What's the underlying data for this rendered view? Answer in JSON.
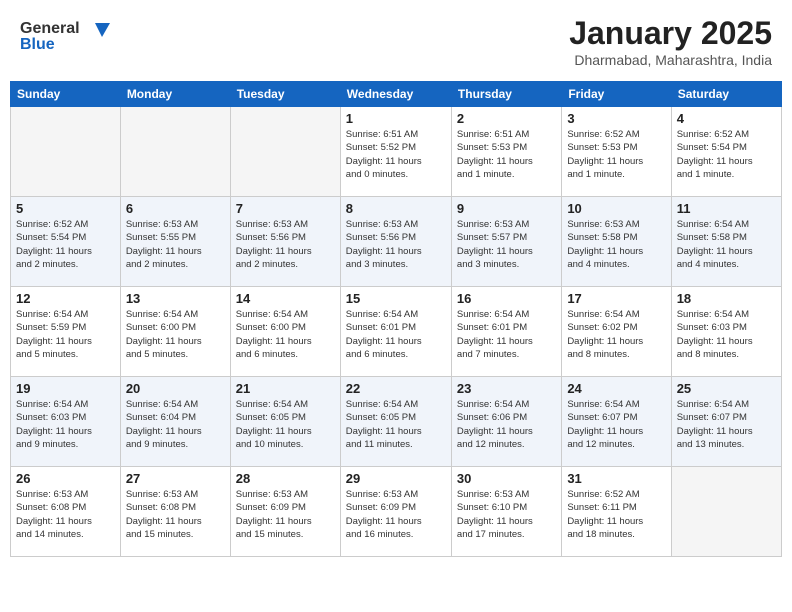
{
  "header": {
    "logo_general": "General",
    "logo_blue": "Blue",
    "month_title": "January 2025",
    "subtitle": "Dharmabad, Maharashtra, India"
  },
  "weekdays": [
    "Sunday",
    "Monday",
    "Tuesday",
    "Wednesday",
    "Thursday",
    "Friday",
    "Saturday"
  ],
  "weeks": [
    [
      {
        "day": "",
        "info": ""
      },
      {
        "day": "",
        "info": ""
      },
      {
        "day": "",
        "info": ""
      },
      {
        "day": "1",
        "info": "Sunrise: 6:51 AM\nSunset: 5:52 PM\nDaylight: 11 hours\nand 0 minutes."
      },
      {
        "day": "2",
        "info": "Sunrise: 6:51 AM\nSunset: 5:53 PM\nDaylight: 11 hours\nand 1 minute."
      },
      {
        "day": "3",
        "info": "Sunrise: 6:52 AM\nSunset: 5:53 PM\nDaylight: 11 hours\nand 1 minute."
      },
      {
        "day": "4",
        "info": "Sunrise: 6:52 AM\nSunset: 5:54 PM\nDaylight: 11 hours\nand 1 minute."
      }
    ],
    [
      {
        "day": "5",
        "info": "Sunrise: 6:52 AM\nSunset: 5:54 PM\nDaylight: 11 hours\nand 2 minutes."
      },
      {
        "day": "6",
        "info": "Sunrise: 6:53 AM\nSunset: 5:55 PM\nDaylight: 11 hours\nand 2 minutes."
      },
      {
        "day": "7",
        "info": "Sunrise: 6:53 AM\nSunset: 5:56 PM\nDaylight: 11 hours\nand 2 minutes."
      },
      {
        "day": "8",
        "info": "Sunrise: 6:53 AM\nSunset: 5:56 PM\nDaylight: 11 hours\nand 3 minutes."
      },
      {
        "day": "9",
        "info": "Sunrise: 6:53 AM\nSunset: 5:57 PM\nDaylight: 11 hours\nand 3 minutes."
      },
      {
        "day": "10",
        "info": "Sunrise: 6:53 AM\nSunset: 5:58 PM\nDaylight: 11 hours\nand 4 minutes."
      },
      {
        "day": "11",
        "info": "Sunrise: 6:54 AM\nSunset: 5:58 PM\nDaylight: 11 hours\nand 4 minutes."
      }
    ],
    [
      {
        "day": "12",
        "info": "Sunrise: 6:54 AM\nSunset: 5:59 PM\nDaylight: 11 hours\nand 5 minutes."
      },
      {
        "day": "13",
        "info": "Sunrise: 6:54 AM\nSunset: 6:00 PM\nDaylight: 11 hours\nand 5 minutes."
      },
      {
        "day": "14",
        "info": "Sunrise: 6:54 AM\nSunset: 6:00 PM\nDaylight: 11 hours\nand 6 minutes."
      },
      {
        "day": "15",
        "info": "Sunrise: 6:54 AM\nSunset: 6:01 PM\nDaylight: 11 hours\nand 6 minutes."
      },
      {
        "day": "16",
        "info": "Sunrise: 6:54 AM\nSunset: 6:01 PM\nDaylight: 11 hours\nand 7 minutes."
      },
      {
        "day": "17",
        "info": "Sunrise: 6:54 AM\nSunset: 6:02 PM\nDaylight: 11 hours\nand 8 minutes."
      },
      {
        "day": "18",
        "info": "Sunrise: 6:54 AM\nSunset: 6:03 PM\nDaylight: 11 hours\nand 8 minutes."
      }
    ],
    [
      {
        "day": "19",
        "info": "Sunrise: 6:54 AM\nSunset: 6:03 PM\nDaylight: 11 hours\nand 9 minutes."
      },
      {
        "day": "20",
        "info": "Sunrise: 6:54 AM\nSunset: 6:04 PM\nDaylight: 11 hours\nand 9 minutes."
      },
      {
        "day": "21",
        "info": "Sunrise: 6:54 AM\nSunset: 6:05 PM\nDaylight: 11 hours\nand 10 minutes."
      },
      {
        "day": "22",
        "info": "Sunrise: 6:54 AM\nSunset: 6:05 PM\nDaylight: 11 hours\nand 11 minutes."
      },
      {
        "day": "23",
        "info": "Sunrise: 6:54 AM\nSunset: 6:06 PM\nDaylight: 11 hours\nand 12 minutes."
      },
      {
        "day": "24",
        "info": "Sunrise: 6:54 AM\nSunset: 6:07 PM\nDaylight: 11 hours\nand 12 minutes."
      },
      {
        "day": "25",
        "info": "Sunrise: 6:54 AM\nSunset: 6:07 PM\nDaylight: 11 hours\nand 13 minutes."
      }
    ],
    [
      {
        "day": "26",
        "info": "Sunrise: 6:53 AM\nSunset: 6:08 PM\nDaylight: 11 hours\nand 14 minutes."
      },
      {
        "day": "27",
        "info": "Sunrise: 6:53 AM\nSunset: 6:08 PM\nDaylight: 11 hours\nand 15 minutes."
      },
      {
        "day": "28",
        "info": "Sunrise: 6:53 AM\nSunset: 6:09 PM\nDaylight: 11 hours\nand 15 minutes."
      },
      {
        "day": "29",
        "info": "Sunrise: 6:53 AM\nSunset: 6:09 PM\nDaylight: 11 hours\nand 16 minutes."
      },
      {
        "day": "30",
        "info": "Sunrise: 6:53 AM\nSunset: 6:10 PM\nDaylight: 11 hours\nand 17 minutes."
      },
      {
        "day": "31",
        "info": "Sunrise: 6:52 AM\nSunset: 6:11 PM\nDaylight: 11 hours\nand 18 minutes."
      },
      {
        "day": "",
        "info": ""
      }
    ]
  ]
}
